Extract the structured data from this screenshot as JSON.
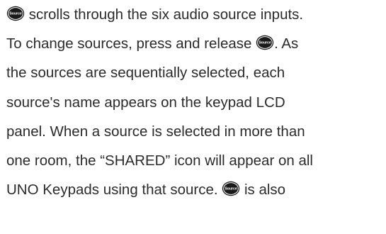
{
  "icon": {
    "name": "source-button-icon",
    "label": "Source",
    "fill": "#1a1a1a",
    "text_color": "#ffffff"
  },
  "paragraph": {
    "line1_after_icon": " scrolls through the six audio source inputs.",
    "line2_before_icon": "To change sources, press and release ",
    "line2_after_icon": ". As",
    "line3": "the sources are sequentially selected, each",
    "line4": "source's name appears on the keypad LCD",
    "line5": "panel. When a source is selected in more than",
    "line6": "one room, the “SHARED” icon will appear on all",
    "line7_before_icon": "UNO Keypads using that source. ",
    "line7_after_icon": " is also"
  }
}
